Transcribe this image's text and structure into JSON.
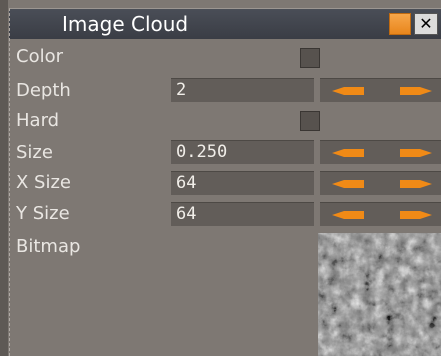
{
  "window": {
    "title": "Image Cloud",
    "close_glyph": "✕"
  },
  "properties": {
    "color": {
      "label": "Color"
    },
    "depth": {
      "label": "Depth",
      "value": "2"
    },
    "hard": {
      "label": "Hard"
    },
    "size": {
      "label": "Size",
      "value": "0.250"
    },
    "x_size": {
      "label": "X Size",
      "value": "64"
    },
    "y_size": {
      "label": "Y Size",
      "value": "64"
    },
    "bitmap": {
      "label": "Bitmap"
    }
  },
  "colors": {
    "accent_orange": "#f08a16",
    "panel_bg": "#7e7873",
    "field_bg": "#625d59",
    "title_bg": "#3f434b"
  },
  "icons": {
    "decrement": "arrow-left-icon",
    "increment": "arrow-right-icon"
  }
}
